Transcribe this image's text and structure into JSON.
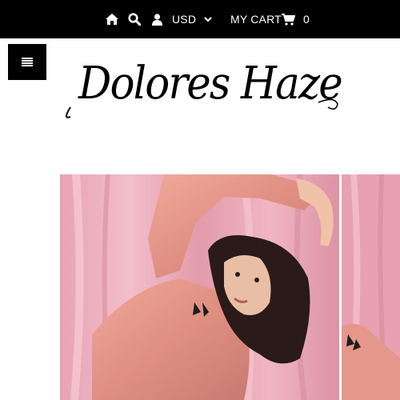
{
  "topbar": {
    "home_icon": "home-icon",
    "search_icon": "search-icon",
    "account_icon": "user-icon",
    "currency": "USD",
    "currency_dropdown_icon": "chevron-down-icon",
    "cart_label": "MY CART",
    "cart_icon": "shopping-cart-icon",
    "cart_count": "0"
  },
  "menu": {
    "icon": "hamburger-icon"
  },
  "logo": {
    "text": "Dolores Haze"
  },
  "hero": {
    "slides": [
      "model-in-pink-satin-shirt",
      "model-in-pink-satin-shirt-partial"
    ],
    "colors": {
      "background": "#e9a3b0",
      "shirt": "#e8988a"
    }
  }
}
